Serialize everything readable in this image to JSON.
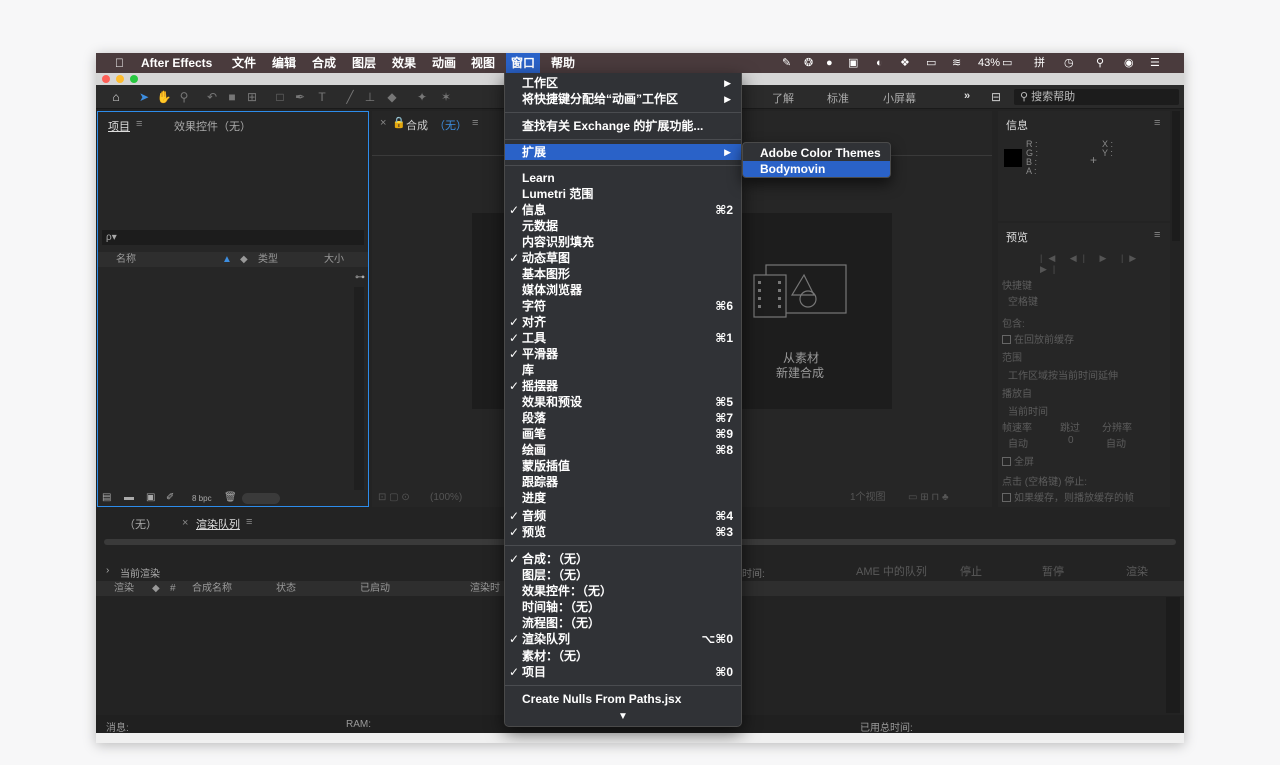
{
  "menubar": {
    "apple_icon": "apple-icon",
    "app_name": "After Effects",
    "items": [
      "文件",
      "编辑",
      "合成",
      "图层",
      "效果",
      "动画",
      "视图",
      "窗口",
      "帮助"
    ],
    "active_item": "窗口",
    "battery": "43%",
    "status_icons": [
      "pen-icon",
      "wechat-icon",
      "browser-icon",
      "display-icon",
      "bird-icon",
      "wechat-icon",
      "keyboard-icon",
      "wifi-icon",
      "battery-icon",
      "input-icon",
      "clock-icon",
      "search-icon",
      "siri-icon",
      "list-icon"
    ]
  },
  "toolbar": {
    "workspaces": [
      "了解",
      "标准",
      "小屏幕"
    ],
    "more": "»",
    "search_help": "搜索帮助"
  },
  "project_panel": {
    "tab_project": "项目",
    "tab_effects": "效果控件（无）",
    "search_icon": "ρ▾",
    "col_name": "名称",
    "col_type": "类型",
    "col_size": "大小",
    "bpc": "8 bpc"
  },
  "comp_panel": {
    "tab": "合成",
    "tab_value": "（无）",
    "placeholder_line1": "从素材",
    "placeholder_line2": "新建合成",
    "zoom": "(100%)",
    "views": "1个视图"
  },
  "info_panel": {
    "title": "信息",
    "r": "R :",
    "g": "G :",
    "b": "B :",
    "a": "A :",
    "x": "X :",
    "y": "Y :"
  },
  "preview_panel": {
    "title": "预览",
    "shortcut_label": "快捷键",
    "shortcut_value": "空格键",
    "include_label": "包含:",
    "cache_before": "在回放前缓存",
    "range_label": "范围",
    "range_value": "工作区域按当前时间延伸",
    "play_from_label": "播放自",
    "play_from_value": "当前时间",
    "fps_label": "帧速率",
    "skip_label": "跳过",
    "resolution_label": "分辨率",
    "fps_value": "自动",
    "skip_value": "0",
    "resolution_value": "自动",
    "fullscreen": "全屏",
    "stop_label": "点击 (空格键) 停止:",
    "stop_option": "如果缓存，则播放缓存的帧"
  },
  "render_panel": {
    "tab_none": "（无）",
    "tab_render": "渲染队列",
    "current_render": "当前渲染",
    "elapsed": "时间:",
    "ame_queue": "AME 中的队列",
    "stop": "停止",
    "pause": "暂停",
    "render": "渲染",
    "col_render": "渲染",
    "col_num": "#",
    "col_comp": "合成名称",
    "col_status": "状态",
    "col_started": "已启动",
    "col_render_time": "渲染时"
  },
  "statusbar": {
    "messages": "消息:",
    "ram": "RAM:",
    "elapsed_total": "已用总时间:"
  },
  "window_menu": {
    "items": [
      {
        "label": "工作区",
        "arrow": true
      },
      {
        "label": "将快捷键分配给“动画”工作区",
        "arrow": true
      },
      {
        "label": "查找有关 Exchange 的扩展功能..."
      },
      {
        "label": "扩展",
        "arrow": true,
        "highlight": true
      },
      {
        "label": "Learn"
      },
      {
        "label": "Lumetri 范围"
      },
      {
        "label": "信息",
        "check": true,
        "shortcut": "⌘2"
      },
      {
        "label": "元数据"
      },
      {
        "label": "内容识别填充"
      },
      {
        "label": "动态草图",
        "check": true
      },
      {
        "label": "基本图形"
      },
      {
        "label": "媒体浏览器"
      },
      {
        "label": "字符",
        "shortcut": "⌘6"
      },
      {
        "label": "对齐",
        "check": true
      },
      {
        "label": "工具",
        "check": true,
        "shortcut": "⌘1"
      },
      {
        "label": "平滑器",
        "check": true
      },
      {
        "label": "库"
      },
      {
        "label": "摇摆器",
        "check": true
      },
      {
        "label": "效果和预设",
        "shortcut": "⌘5"
      },
      {
        "label": "段落",
        "shortcut": "⌘7"
      },
      {
        "label": "画笔",
        "shortcut": "⌘9"
      },
      {
        "label": "绘画",
        "shortcut": "⌘8"
      },
      {
        "label": "蒙版插值"
      },
      {
        "label": "跟踪器"
      },
      {
        "label": "进度"
      },
      {
        "label": "音频",
        "check": true,
        "shortcut": "⌘4"
      },
      {
        "label": "预览",
        "check": true,
        "shortcut": "⌘3"
      },
      {
        "label": "合成：（无）",
        "check": true
      },
      {
        "label": "图层：（无）"
      },
      {
        "label": "效果控件：（无）"
      },
      {
        "label": "时间轴：（无）"
      },
      {
        "label": "流程图：（无）"
      },
      {
        "label": "渲染队列",
        "check": true,
        "shortcut": "⌥⌘0"
      },
      {
        "label": "素材：（无）"
      },
      {
        "label": "项目",
        "check": true,
        "shortcut": "⌘0"
      },
      {
        "label": "Create Nulls From Paths.jsx"
      }
    ],
    "more_arrow": "▼"
  },
  "extension_submenu": {
    "items": [
      {
        "label": "Adobe Color Themes"
      },
      {
        "label": "Bodymovin",
        "highlight": true
      }
    ]
  },
  "colors": {
    "menu_highlight": "#2a62c8",
    "menubar_bg": "#4a3b3d",
    "panel_bg": "#262626",
    "project_focus": "#2d8ceb"
  }
}
